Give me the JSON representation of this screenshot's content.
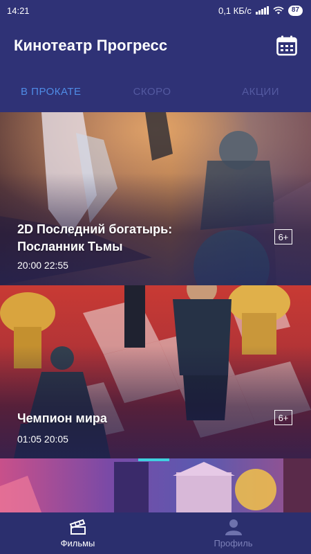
{
  "status": {
    "time": "14:21",
    "speed": "0,1 КБ/с",
    "battery": "87"
  },
  "app": {
    "title": "Кинотеатр Прогресс",
    "calendar_icon": "calendar-icon"
  },
  "tabs": [
    {
      "label": "В ПРОКАТЕ",
      "active": true
    },
    {
      "label": "СКОРО",
      "active": false
    },
    {
      "label": "АКЦИИ",
      "active": false
    }
  ],
  "movies": [
    {
      "title_line1": "2D Последний богатырь:",
      "title_line2": "Посланник Тьмы",
      "times": "20:00 22:55",
      "age": "6+"
    },
    {
      "title_line1": "Чемпион мира",
      "times": "01:05 20:05",
      "age": "6+"
    },
    {
      "title_line1": ""
    }
  ],
  "bottom_nav": [
    {
      "label": "Фильмы",
      "icon": "ticket-icon",
      "active": true
    },
    {
      "label": "Профиль",
      "icon": "profile-icon",
      "active": false
    }
  ],
  "colors": {
    "primary": "#2f3276",
    "tab_active": "#4f8ce6",
    "tab_inactive": "#545aa1"
  }
}
